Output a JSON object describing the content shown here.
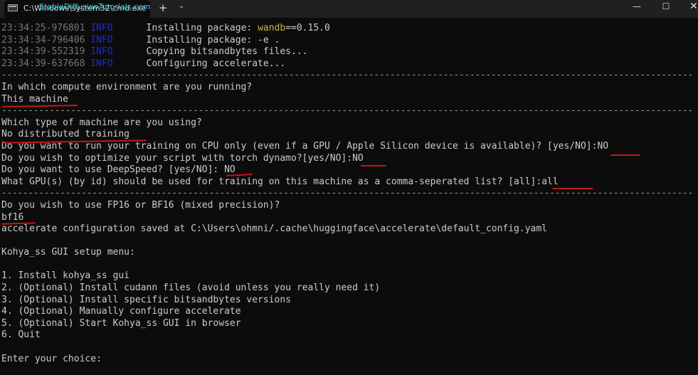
{
  "window": {
    "tab_title": "C:\\Windows\\system32\\cmd.exe",
    "watermark": "StableDiffusionTutorials.com",
    "new_tab_label": "+",
    "dropdown_label": "⌄",
    "minimize_label": "—",
    "maximize_label": "☐",
    "close_label": "✕"
  },
  "log": [
    {
      "ts": "23:34:25-976801",
      "level": "INFO",
      "msg": "Installing package: ",
      "highlight": "wandb",
      "rest": "==0.15.0"
    },
    {
      "ts": "23:34:34-796406",
      "level": "INFO",
      "msg": "Installing package: -e .",
      "highlight": "",
      "rest": ""
    },
    {
      "ts": "23:34:39-552319",
      "level": "INFO",
      "msg": "Copying bitsandbytes files...",
      "highlight": "",
      "rest": ""
    },
    {
      "ts": "23:34:39-637668",
      "level": "INFO",
      "msg": "Configuring accelerate...",
      "highlight": "",
      "rest": ""
    }
  ],
  "separator": "----------------------------------------------------------------------------------------------------------------------------------",
  "config": {
    "q_env": "In which compute environment are you running?",
    "a_env": "This machine",
    "q_machine": "Which type of machine are you using?",
    "a_machine": "No distributed training",
    "q_cpu": "Do you want to run your training on CPU only (even if a GPU / Apple Silicon device is available)? [yes/NO]:",
    "a_cpu": "NO",
    "q_dynamo": "Do you wish to optimize your script with torch dynamo?[yes/NO]:",
    "a_dynamo": "NO",
    "q_deepspeed": "Do you want to use DeepSpeed? [yes/NO]: ",
    "a_deepspeed": "NO",
    "q_gpu": "What GPU(s) (by id) should be used for training on this machine as a comma-seperated list? [all]:",
    "a_gpu": "all",
    "q_precision": "Do you wish to use FP16 or BF16 (mixed precision)?",
    "a_precision": "bf16",
    "saved": "accelerate configuration saved at C:\\Users\\ohmni/.cache\\huggingface\\accelerate\\default_config.yaml"
  },
  "menu": {
    "title": "Kohya_ss GUI setup menu:",
    "items": [
      "1. Install kohya_ss gui",
      "2. (Optional) Install cudann files (avoid unless you really need it)",
      "3. (Optional) Install specific bitsandbytes versions",
      "4. (Optional) Manually configure accelerate",
      "5. (Optional) Start Kohya_ss GUI in browser",
      "6. Quit"
    ],
    "prompt": "Enter your choice:"
  }
}
